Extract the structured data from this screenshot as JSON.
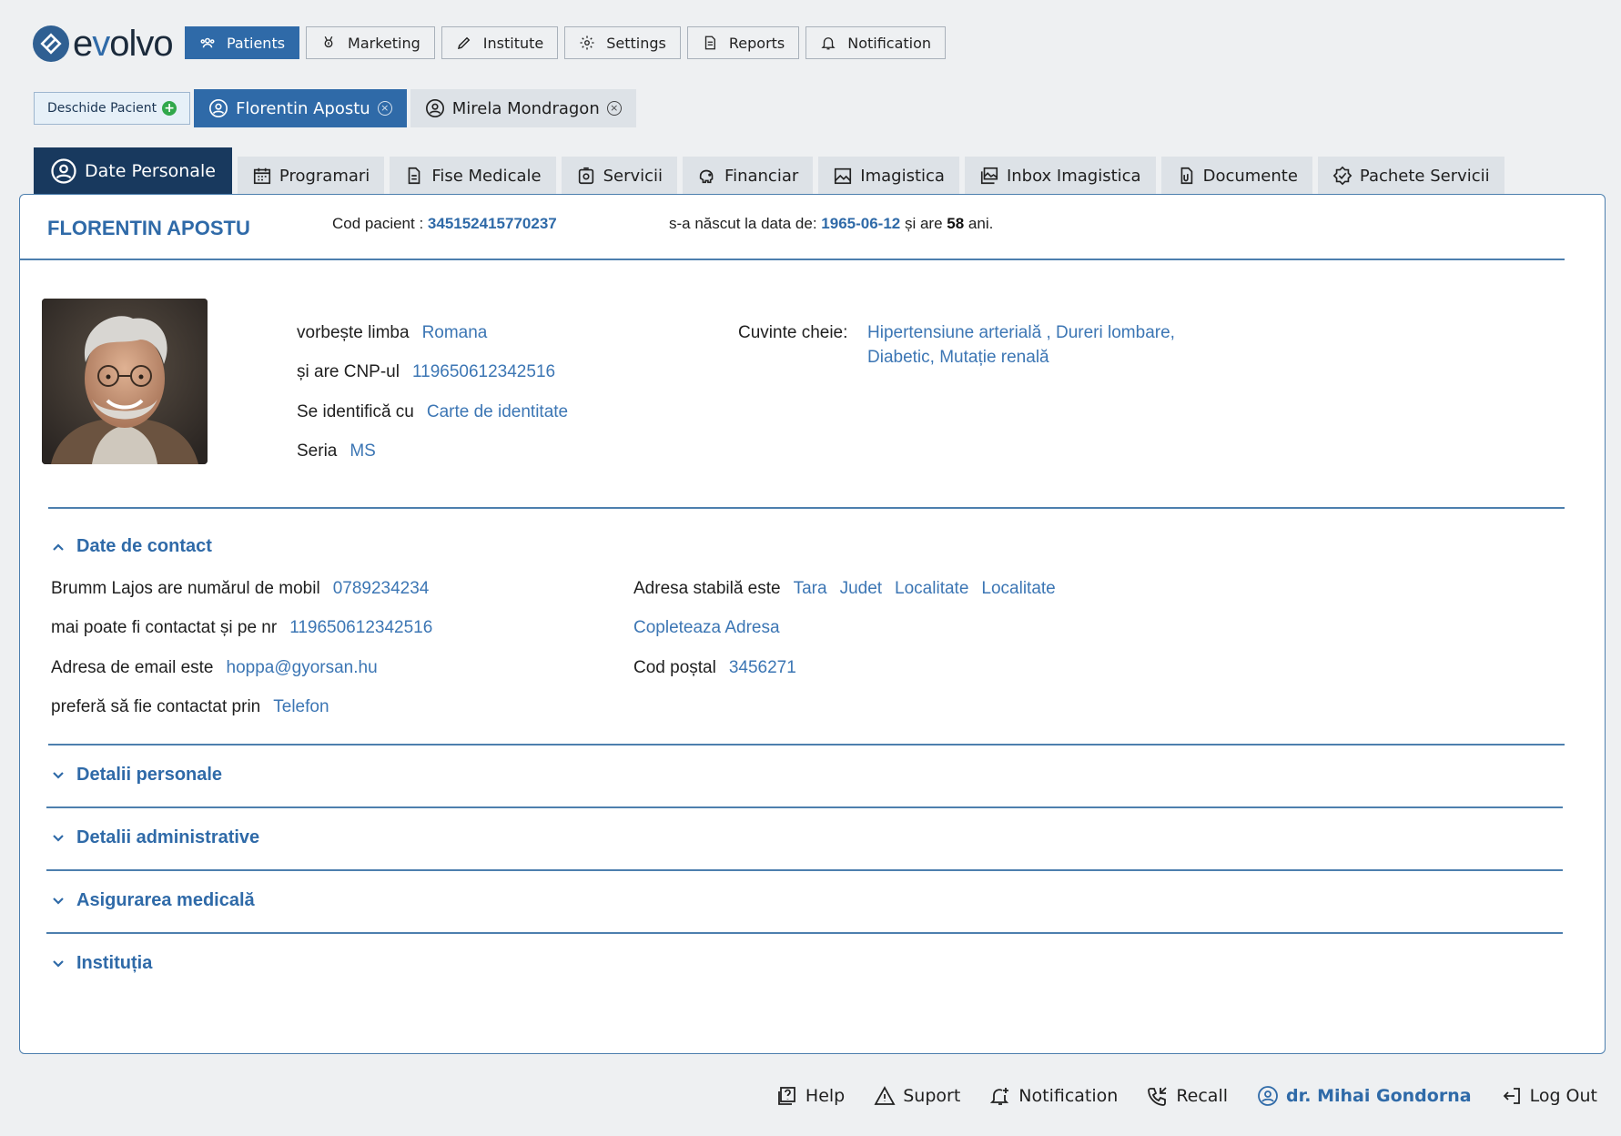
{
  "brand": {
    "name_pre": "e",
    "name_o": "v",
    "name_post": "olvo"
  },
  "nav": [
    {
      "label": "Patients",
      "icon": "users-icon",
      "active": true
    },
    {
      "label": "Marketing",
      "icon": "award-icon"
    },
    {
      "label": "Institute",
      "icon": "pen-icon"
    },
    {
      "label": "Settings",
      "icon": "gear-icon"
    },
    {
      "label": "Reports",
      "icon": "report-icon"
    },
    {
      "label": "Notification",
      "icon": "bell-icon"
    }
  ],
  "patient_tabs": {
    "open_label": "Deschide Pacient",
    "tabs": [
      {
        "label": "Florentin Apostu",
        "active": true
      },
      {
        "label": "Mirela Mondragon",
        "active": false
      }
    ]
  },
  "section_tabs": [
    {
      "label": "Date Personale",
      "icon": "user-circle-icon",
      "active": true
    },
    {
      "label": "Programari",
      "icon": "calendar-icon"
    },
    {
      "label": "Fise Medicale",
      "icon": "document-icon"
    },
    {
      "label": "Servicii",
      "icon": "services-icon"
    },
    {
      "label": "Financiar",
      "icon": "piggy-bank-icon"
    },
    {
      "label": "Imagistica",
      "icon": "image-icon"
    },
    {
      "label": "Inbox Imagistica",
      "icon": "images-inbox-icon"
    },
    {
      "label": "Documente",
      "icon": "files-icon"
    },
    {
      "label": "Pachete Servicii",
      "icon": "badge-check-icon"
    }
  ],
  "header": {
    "name": "FLORENTIN APOSTU",
    "code_label": "Cod pacient : ",
    "code_value": "345152415770237",
    "born_label": "s-a născut la data de: ",
    "born_value": "1965-06-12",
    "age_label": " și are ",
    "age_value": "58",
    "age_suffix": " ani."
  },
  "personal": {
    "language_label": "vorbește limba",
    "language_value": "Romana",
    "cnp_label": "și are CNP-ul",
    "cnp_value": "119650612342516",
    "id_label": "Se identifică cu",
    "id_value": "Carte de identitate",
    "series_label": "Seria",
    "series_value": "MS",
    "keywords_label": "Cuvinte cheie:",
    "keywords_line1": "Hipertensiune arterială , Dureri lombare,",
    "keywords_line2": "Diabetic, Mutație renală"
  },
  "contact": {
    "title": "Date de contact",
    "mobile_label": "Brumm Lajos are numărul de mobil",
    "mobile_value": "0789234234",
    "alt_label": "mai poate fi contactat și pe nr",
    "alt_value": "119650612342516",
    "email_label": "Adresa de email este",
    "email_value": "hoppa@gyorsan.hu",
    "pref_label": "preferă să fie contactat prin",
    "pref_value": "Telefon",
    "addr_label": "Adresa stabilă este",
    "addr_tara": "Tara",
    "addr_judet": "Judet",
    "addr_loc1": "Localitate",
    "addr_loc2": "Localitate",
    "complete_addr": "Copleteaza Adresa",
    "postal_label": "Cod poștal",
    "postal_value": "3456271"
  },
  "accordions": [
    "Detalii personale",
    "Detalii administrative",
    "Asigurarea medicală",
    "Instituția"
  ],
  "footer": {
    "help": "Help",
    "support": "Suport",
    "notification": "Notification",
    "recall": "Recall",
    "user": "dr. Mihai Gondorna",
    "logout": "Log Out"
  },
  "colors": {
    "primary": "#2f6aa8",
    "dark_tab": "#18395e",
    "link": "#3c76b4",
    "add": "#31a84b"
  }
}
